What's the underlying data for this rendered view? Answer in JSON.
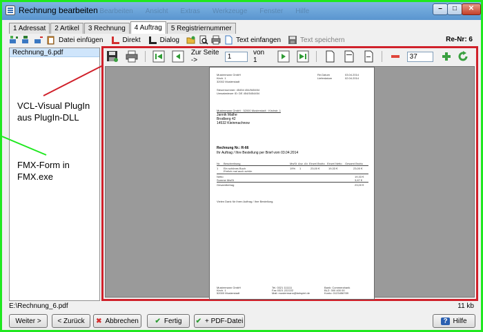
{
  "window": {
    "title": "Rechnung bearbeiten",
    "ghost_menu": [
      "Datei",
      "Bearbeiten",
      "Ansicht",
      "Extras",
      "Werkzeuge",
      "Fenster",
      "Hilfe"
    ]
  },
  "tabs": [
    {
      "label": "1 Adressat"
    },
    {
      "label": "2 Artikel"
    },
    {
      "label": "3 Rechnung"
    },
    {
      "label": "4 Auftrag"
    },
    {
      "label": "5 Registriernummer"
    }
  ],
  "toolbar": {
    "datei_einfuegen": "Datei einfügen",
    "direkt": "Direkt",
    "dialog": "Dialog",
    "text_einfangen": "Text einfangen",
    "text_speichern": "Text speichern",
    "renr": "Re-Nr: 6"
  },
  "filelist": {
    "items": [
      "Rechnung_6.pdf"
    ]
  },
  "viewer": {
    "zur_seite": "Zur Seite ->",
    "page": "1",
    "von": "von 1",
    "zoom": "37",
    "colors": {
      "frame": "#d0202a",
      "canvas": "#9a9a9a"
    }
  },
  "document": {
    "sender_lines": [
      "Mustermann GmbH",
      "Kirch. 1",
      "32002 Musterstadt"
    ],
    "date_labels": [
      "Re.Datum",
      "Lieferdatum"
    ],
    "dates": [
      "03.04.2014",
      "02.04.2014"
    ],
    "tax_lines": [
      "Steuernummer: 45454 454/545454",
      "Umsatzsteuer ID: DE 454/5454454"
    ],
    "sender_small": "Mustermann GmbH · 52000 Musterstadt · Kirchstr. 1",
    "recipient": [
      "Jannik Mathe",
      "Brodberg 42",
      "14532 Kleinmachnow"
    ],
    "invoice_title": "Rechnung Nr.: R-66",
    "order_line": "Ihr Auftrag / Ihre Bestellung per Brief vom 03.04.2014",
    "table_header": [
      "Nr.",
      "Beschreibung",
      "MwSt",
      "Anz. Ah",
      "Einzel Brutto",
      "Einzel Netto",
      "Gesamt Brutto"
    ],
    "table_row": [
      "1",
      "Ein schönes Buch",
      "19%",
      "1",
      "23,00 €",
      "19,33 €",
      "23,00 €"
    ],
    "table_row_note": "Ehrlich mal auch schön",
    "sums": [
      {
        "label": "Netto",
        "value": "19,33 €"
      },
      {
        "label": "Summe MwSt",
        "value": "3,67 €"
      },
      {
        "label": "Gesamtbetrag",
        "value": "23,00 €"
      }
    ],
    "thanks": "Vielen Dank für Ihren Auftrag / Ihre Bestellung.",
    "footer_cols": [
      [
        "Mustermann GmbH",
        "Kirch. 1",
        "52000 Musterstadt"
      ],
      [
        "Tel. 0321 111111",
        "Fax 0321 222222",
        "Mail: mustermann@beispiel.de"
      ],
      [
        "Bank: Commerzbank",
        "BLZ: 300 400 00",
        "Konto: 0123456789"
      ]
    ]
  },
  "annotations": {
    "vcl_line1": "VCL-Visual PlugIn",
    "vcl_line2": "aus PlugIn-DLL",
    "fmx_line1": "FMX-Form in",
    "fmx_line2": "FMX.exe",
    "colors": {
      "vcl": "#d0202a",
      "fmx": "#1fe81f"
    }
  },
  "status": {
    "path": "E:\\Rechnung_6.pdf",
    "size": "11 kb"
  },
  "buttons": {
    "weiter": "Weiter >",
    "zurueck": "< Zurück",
    "abbrechen": "Abbrechen",
    "fertig": "Fertig",
    "pdf": "+ PDF-Datei",
    "hilfe": "Hilfe"
  }
}
